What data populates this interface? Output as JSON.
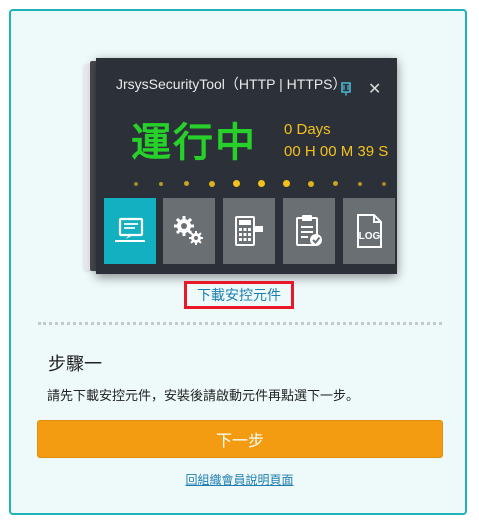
{
  "tool_window": {
    "title": "JrsysSecurityTool（HTTP | HTTPS）",
    "status": "運行中",
    "days": "0 Days",
    "time": "00 H 00 M 39 S",
    "accent_color": "#27d12a",
    "counter_color": "#f4c21b",
    "tiles": [
      {
        "icon": "monitor-chat-icon",
        "active": true
      },
      {
        "icon": "gears-icon",
        "active": false
      },
      {
        "icon": "calculator-icon",
        "active": false
      },
      {
        "icon": "clipboard-check-icon",
        "active": false
      },
      {
        "icon": "log-file-icon",
        "active": false
      }
    ],
    "log_label": "LOG"
  },
  "download_link": "下載安控元件",
  "step": {
    "title": "步驟一",
    "instruction": "請先下載安控元件，安裝後請啟動元件再點選下一步。"
  },
  "next_button": "下一步",
  "help_link": "回組織會員說明頁面",
  "colors": {
    "panel_border": "#1eb3b8",
    "panel_background": "#eef9fa",
    "button": "#f39c12",
    "link": "#1d7fb0",
    "highlight_box": "#e8182a"
  }
}
